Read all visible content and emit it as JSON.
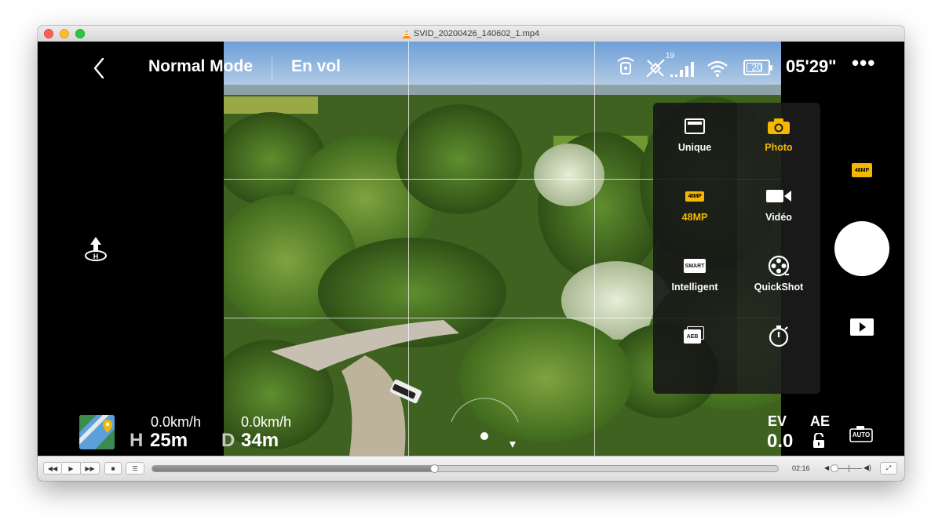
{
  "window": {
    "title": "SVID_20200426_140602_1.mp4"
  },
  "hud": {
    "back_icon": "chevron-left-icon",
    "mode": "Normal Mode",
    "status": "En vol",
    "signal_count": "19",
    "battery": "20",
    "flight_time": "05'29\"",
    "more_icon": "ellipsis-icon"
  },
  "telemetry": {
    "h_speed": "0.0km/h",
    "v_speed": "0.0km/h",
    "h_label": "H",
    "h_value": "25m",
    "d_label": "D",
    "d_value": "34m"
  },
  "exposure": {
    "ev_label": "EV",
    "ev_value": "0.0",
    "ae_label": "AE",
    "auto_label": "AUTO"
  },
  "right_panel": {
    "res_badge": "48MP"
  },
  "menu": {
    "items": [
      {
        "label": "Unique",
        "icon": "single-shot-icon",
        "active": false
      },
      {
        "label": "Photo",
        "icon": "camera-icon",
        "active": true
      },
      {
        "label": "48MP",
        "icon": "48mp-icon",
        "active": true
      },
      {
        "label": "Vidéo",
        "icon": "video-camera-icon",
        "active": false
      },
      {
        "label": "Intelligent",
        "icon": "smart-icon",
        "active": false
      },
      {
        "label": "QuickShot",
        "icon": "film-reel-icon",
        "active": false
      },
      {
        "label": "",
        "icon": "aeb-icon",
        "active": false
      },
      {
        "label": "",
        "icon": "timer-icon",
        "active": false
      }
    ],
    "smart_badge": "SMART",
    "aeb_badge": "AEB"
  },
  "player": {
    "elapsed": "02:16",
    "progress": 0.45,
    "volume": 0.0
  },
  "colors": {
    "accent": "#f5b800",
    "hud_text": "#ffffff"
  }
}
